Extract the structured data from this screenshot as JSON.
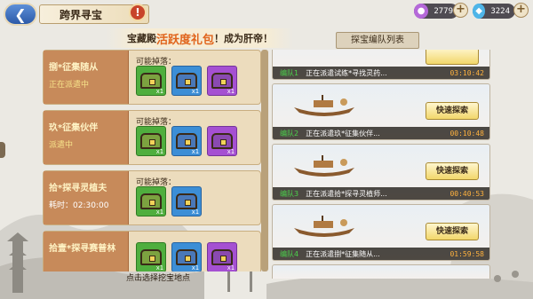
{
  "header": {
    "title": "跨界寻宝",
    "back_icon": "back-arrow-icon",
    "help_icon": "exclamation-icon"
  },
  "currencies": [
    {
      "icon": "purple-gem-icon",
      "value": "2779",
      "color": "#b569d9"
    },
    {
      "icon": "diamond-icon",
      "value": "3224",
      "color": "#4fb5e8"
    }
  ],
  "banner": {
    "prefix": "宝藏殿",
    "highlight": "活跃度礼包",
    "suffix": "！成为肝帝！"
  },
  "right_tab": "探宝编队列表",
  "left_zones": [
    {
      "name": "捌*征集随从",
      "status": "正在派遣中",
      "timer": "",
      "drops_label": "可能掉落：",
      "chests": [
        {
          "color": "green",
          "count": "x1"
        },
        {
          "color": "blue",
          "count": "x1"
        },
        {
          "color": "purple",
          "count": "x1"
        }
      ]
    },
    {
      "name": "玖*征集伙伴",
      "status": "派遣中",
      "timer": "",
      "drops_label": "可能掉落：",
      "chests": [
        {
          "color": "green",
          "count": "x1"
        },
        {
          "color": "blue",
          "count": "x1"
        },
        {
          "color": "purple",
          "count": "x1"
        }
      ]
    },
    {
      "name": "拾*探寻灵植夫",
      "status": "",
      "timer": "耗时：02:30:00",
      "drops_label": "可能掉落：",
      "chests": [
        {
          "color": "green",
          "count": "x1"
        },
        {
          "color": "blue",
          "count": "x1"
        }
      ]
    },
    {
      "name": "拾壹*探寻赛普林",
      "status": "",
      "timer": "",
      "drops_label": "",
      "chests": [
        {
          "color": "green",
          "count": "x1"
        },
        {
          "color": "blue",
          "count": "x1"
        },
        {
          "color": "purple",
          "count": "x1"
        }
      ]
    }
  ],
  "footer": "点击选择挖宝地点",
  "expeditions": [
    {
      "squad": "编队1",
      "text": "正在派遣试练*寻找灵药...",
      "time": "03:10:42",
      "button": ""
    },
    {
      "squad": "编队2",
      "text": "正在派遣玖*征集伙伴...",
      "time": "00:10:48",
      "button": "快速探索"
    },
    {
      "squad": "编队3",
      "text": "正在派遣拾*探寻灵植师...",
      "time": "00:40:53",
      "button": "快速探索"
    },
    {
      "squad": "编队4",
      "text": "正在派遣捌*征集随从...",
      "time": "01:59:58",
      "button": "快速探索"
    }
  ]
}
